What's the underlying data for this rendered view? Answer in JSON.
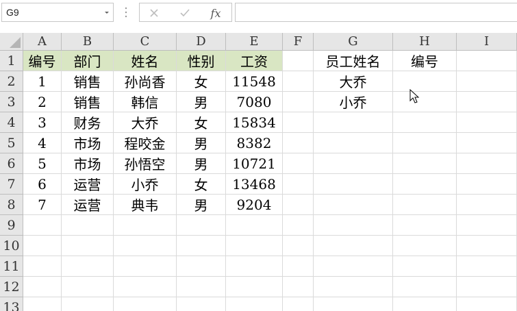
{
  "formula_bar": {
    "name_box": "G9",
    "cancel_icon": "close-icon",
    "enter_icon": "check-icon",
    "function_label": "fx",
    "formula": ""
  },
  "columns": [
    "A",
    "B",
    "C",
    "D",
    "E",
    "F",
    "G",
    "H",
    "I"
  ],
  "rows": [
    "1",
    "2",
    "3",
    "4",
    "5",
    "6",
    "7",
    "8",
    "9",
    "10",
    "11",
    "12",
    "13"
  ],
  "table": {
    "headers": [
      "编号",
      "部门",
      "姓名",
      "性别",
      "工资"
    ],
    "records": [
      [
        "1",
        "销售",
        "孙尚香",
        "女",
        "11548"
      ],
      [
        "2",
        "销售",
        "韩信",
        "男",
        "7080"
      ],
      [
        "3",
        "财务",
        "大乔",
        "女",
        "15834"
      ],
      [
        "4",
        "市场",
        "程咬金",
        "男",
        "8382"
      ],
      [
        "5",
        "市场",
        "孙悟空",
        "男",
        "10721"
      ],
      [
        "6",
        "运营",
        "小乔",
        "女",
        "13468"
      ],
      [
        "7",
        "运营",
        "典韦",
        "男",
        "9204"
      ]
    ]
  },
  "lookup": {
    "headers": [
      "员工姓名",
      "编号"
    ],
    "records": [
      [
        "大乔",
        ""
      ],
      [
        "小乔",
        ""
      ]
    ]
  },
  "colors": {
    "header_fill": "#d9e6c3",
    "grid_line": "#dadada",
    "heading_fill": "#e6e6e6"
  }
}
